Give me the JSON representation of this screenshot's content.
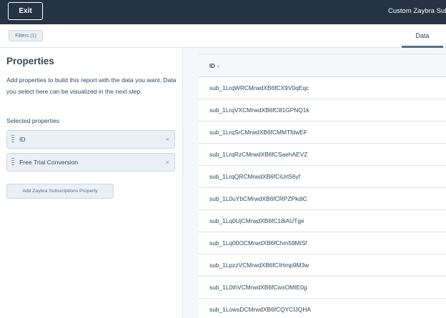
{
  "topbar": {
    "exit_label": "Exit",
    "report_title": "Custom Zaybra Subscriptions Report"
  },
  "toolbar": {
    "filters_label": "Filters (1)",
    "data_tab_label": "Data"
  },
  "properties": {
    "title": "Properties",
    "description": "Add properties to build this report with the data you want. Data you select here can be visualized in the next step.",
    "selected_label": "Selected properties",
    "items": [
      {
        "label": "ID"
      },
      {
        "label": "Free Trial Conversion"
      }
    ],
    "remove_glyph": "×",
    "add_button_label": "Add Zaybra Subscriptions Property"
  },
  "table": {
    "header_id": "ID",
    "sort_glyph": "⇕",
    "rows": [
      "sub_1LrqWRCMrwdXB6fCX9V0qEqc",
      "sub_1LrqVXCMrwdXB6fC81GPNQ1k",
      "sub_1LrqSrCMrwdXB6fCMMTfdwEF",
      "sub_1LrqRzCMrwdXB6fCSaehAEVZ",
      "sub_1LrqQRCMrwdXB6fCiUrt56yf",
      "sub_1L0uYbCMrwdXB6fCRPZPkdiC",
      "sub_1Lq0UjCMrwdXB6fC18iAUTge",
      "sub_1Lq00OCMrwdXB6fChm59MiSf",
      "sub_1LpzzVCMrwdXB6fCIHmp9M3w",
      "sub_1L0thVCMrwdXB6fCwxOMIE0g",
      "sub_1LowsDCMrwdXB6fCQYCIJQHA"
    ]
  }
}
